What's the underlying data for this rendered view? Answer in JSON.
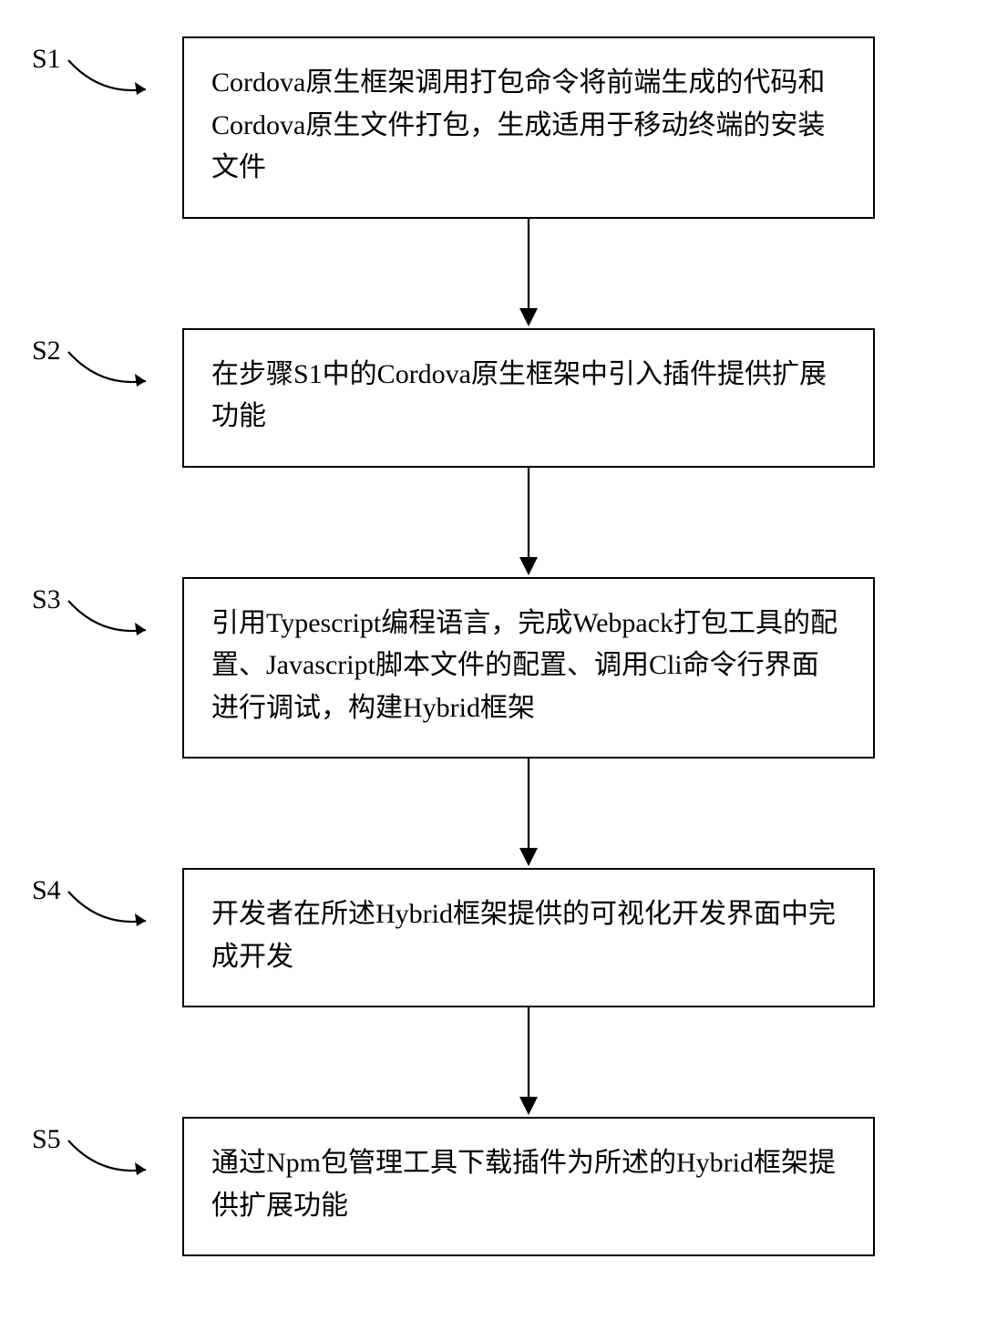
{
  "steps": {
    "s1": {
      "label": "S1",
      "text": "Cordova原生框架调用打包命令将前端生成的代码和Cordova原生文件打包，生成适用于移动终端的安装文件"
    },
    "s2": {
      "label": "S2",
      "text": "在步骤S1中的Cordova原生框架中引入插件提供扩展功能"
    },
    "s3": {
      "label": "S3",
      "text": "引用Typescript编程语言，完成Webpack打包工具的配置、Javascript脚本文件的配置、调用Cli命令行界面进行调试，构建Hybrid框架"
    },
    "s4": {
      "label": "S4",
      "text": "开发者在所述Hybrid框架提供的可视化开发界面中完成开发"
    },
    "s5": {
      "label": "S5",
      "text": "通过Npm包管理工具下载插件为所述的Hybrid框架提供扩展功能"
    }
  }
}
